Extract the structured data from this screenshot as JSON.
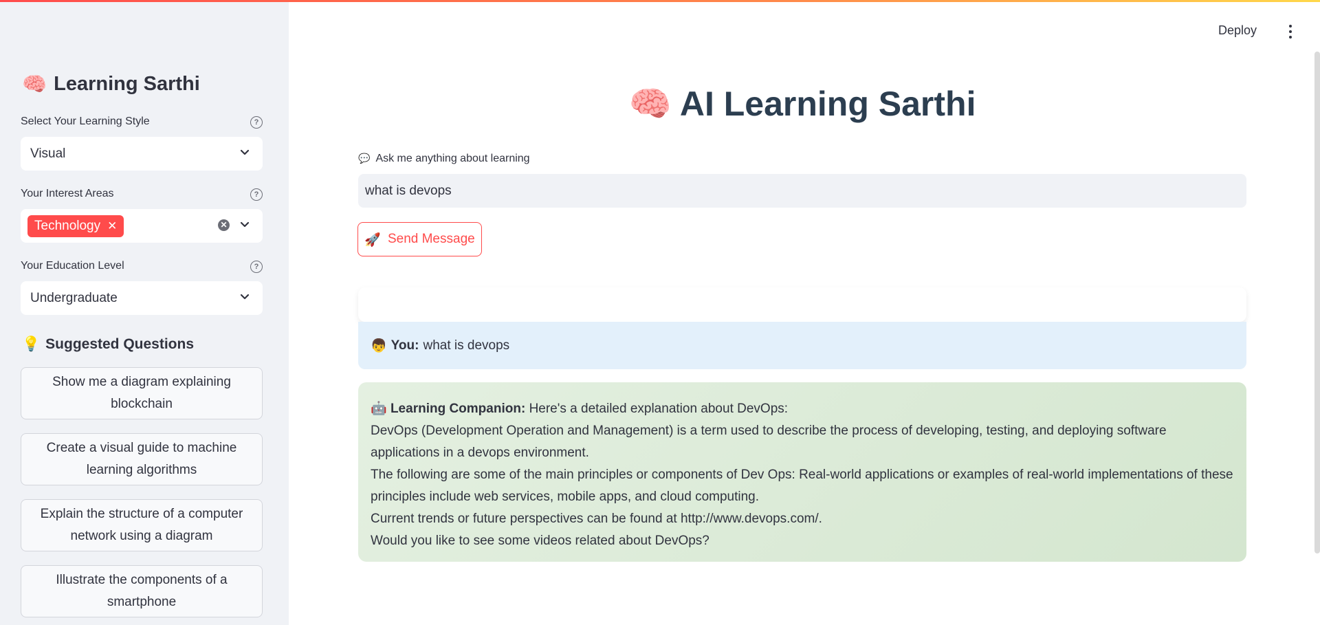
{
  "sidebar": {
    "title_emoji": "🧠",
    "title": "Learning Sarthi",
    "learning_style": {
      "label": "Select Your Learning Style",
      "value": "Visual"
    },
    "interest_areas": {
      "label": "Your Interest Areas",
      "tags": [
        "Technology"
      ]
    },
    "education_level": {
      "label": "Your Education Level",
      "value": "Undergraduate"
    },
    "suggested": {
      "emoji": "💡",
      "header": "Suggested Questions",
      "questions": [
        "Show me a diagram explaining blockchain",
        "Create a visual guide to machine learning algorithms",
        "Explain the structure of a computer network using a diagram",
        "Illustrate the components of a smartphone"
      ]
    }
  },
  "toolbar": {
    "deploy_label": "Deploy"
  },
  "main": {
    "title_emoji": "🧠",
    "title": "AI Learning Sarthi",
    "ask_emoji": "💬",
    "ask_label": "Ask me anything about learning",
    "input_value": "what is devops",
    "send_emoji": "🚀",
    "send_label": "Send Message",
    "user_message": {
      "emoji": "👦",
      "speaker": "You:",
      "text": "what is devops"
    },
    "bot_message": {
      "emoji": "🤖",
      "speaker": "Learning Companion:",
      "intro": "Here's a detailed explanation about DevOps:",
      "lines": [
        "DevOps (Development Operation and Management) is a term used to describe the process of developing, testing, and deploying software applications in a devops environment.",
        "The following are some of the main principles or components of Dev Ops: Real-world applications or examples of real-world implementations of these principles include web services, mobile apps, and cloud computing.",
        "Current trends or future perspectives can be found at http://www.devops.com/.",
        "Would you like to see some videos related about DevOps?"
      ]
    }
  },
  "colors": {
    "accent": "#ff4b4b",
    "sidebar_bg": "#f0f2f6",
    "title": "#2c3e50"
  }
}
